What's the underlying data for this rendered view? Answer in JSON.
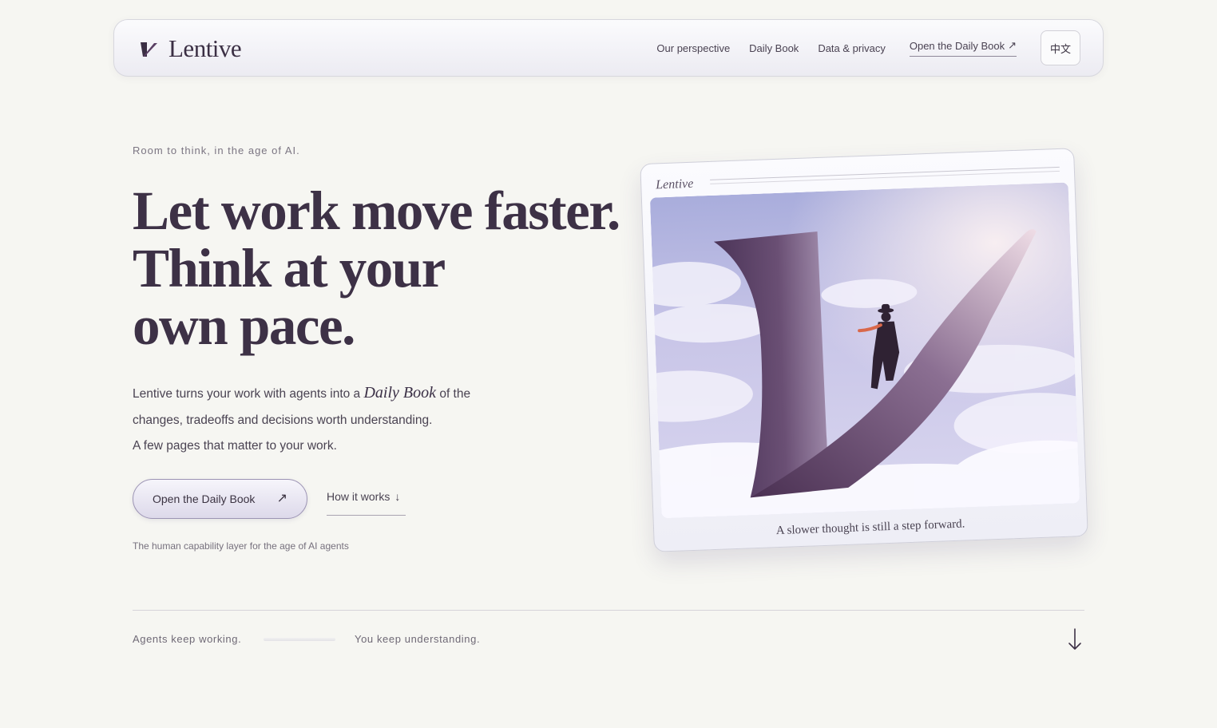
{
  "header": {
    "brand": "Lentive",
    "nav": [
      "Our perspective",
      "Daily Book",
      "Data & privacy"
    ],
    "cta_label": "Open the Daily Book",
    "cta_arrow": "↗",
    "lang_label": "中文"
  },
  "hero": {
    "eyebrow": "Room to think, in the age of AI.",
    "headline": [
      "Let work move faster.",
      "Think at your",
      "own pace."
    ],
    "desc_pre": "Lentive turns your work with agents into a ",
    "desc_em": "Daily Book",
    "desc_post": " of the",
    "desc_line2": "changes, tradeoffs and decisions worth understanding.",
    "desc_line3": "A few pages that matter to your work.",
    "primary_label": "Open the Daily Book",
    "primary_arrow": "↗",
    "secondary_label": "How it works",
    "secondary_arrow": "↓",
    "tagline": "The human capability layer for the age of AI agents"
  },
  "card": {
    "brand": "Lentive",
    "caption": "A slower thought is still a step forward.",
    "image_icon": "lentive-l-path-illustration"
  },
  "footer": {
    "left": "Agents keep working.",
    "right": "You keep understanding.",
    "scroll_icon": "arrow-down-icon"
  },
  "colors": {
    "background": "#f6f6f2",
    "ink": "#3d3146",
    "accent": "#5a3f63"
  }
}
